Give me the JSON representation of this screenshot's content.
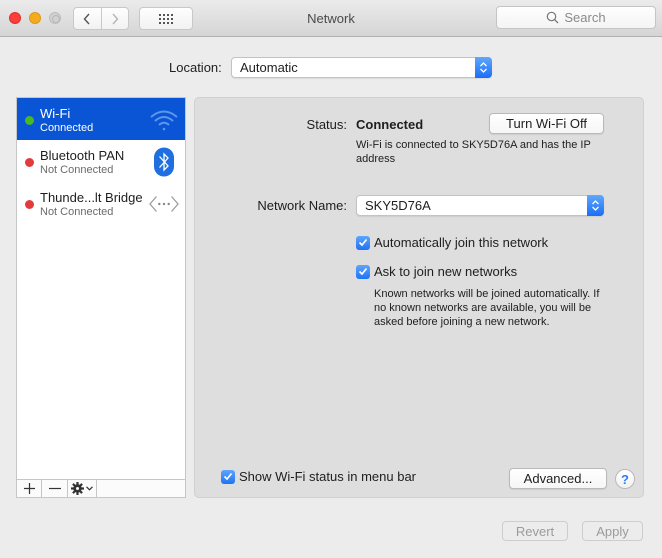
{
  "window": {
    "title": "Network",
    "search_placeholder": "Search",
    "back_label": "<",
    "forward_label": ">"
  },
  "location": {
    "label": "Location:",
    "value": "Automatic"
  },
  "services": [
    {
      "name": "Wi-Fi",
      "status": "Connected",
      "status_color": "#46b924",
      "icon": "wifi-icon",
      "selected": true
    },
    {
      "name": "Bluetooth PAN",
      "status": "Not Connected",
      "status_color": "#e33b3b",
      "icon": "bluetooth-icon",
      "selected": false
    },
    {
      "name": "Thunde...lt Bridge",
      "status": "Not Connected",
      "status_color": "#e33b3b",
      "icon": "thunderbolt-bridge-icon",
      "selected": false
    }
  ],
  "sidebar_toolbar": {
    "add": "+",
    "remove": "—"
  },
  "detail": {
    "status_label": "Status:",
    "status_value": "Connected",
    "turn_off_button": "Turn Wi-Fi Off",
    "status_description": "Wi-Fi is connected to SKY5D76A and has the IP address",
    "network_name_label": "Network Name:",
    "network_name_value": "SKY5D76A",
    "auto_join_label": "Automatically join this network",
    "auto_join_checked": true,
    "ask_join_label": "Ask to join new networks",
    "ask_join_checked": true,
    "ask_join_description": "Known networks will be joined automatically. If no known networks are available, you will be asked before joining a new network.",
    "show_status_label": "Show Wi-Fi status in menu bar",
    "show_status_checked": true,
    "advanced_button": "Advanced...",
    "help_label": "?"
  },
  "footer": {
    "revert_button": "Revert",
    "apply_button": "Apply"
  },
  "colors": {
    "accent": "#0a55d6",
    "checkbox": "#2a7af6",
    "connected": "#46b924",
    "disconnected": "#e33b3b"
  }
}
